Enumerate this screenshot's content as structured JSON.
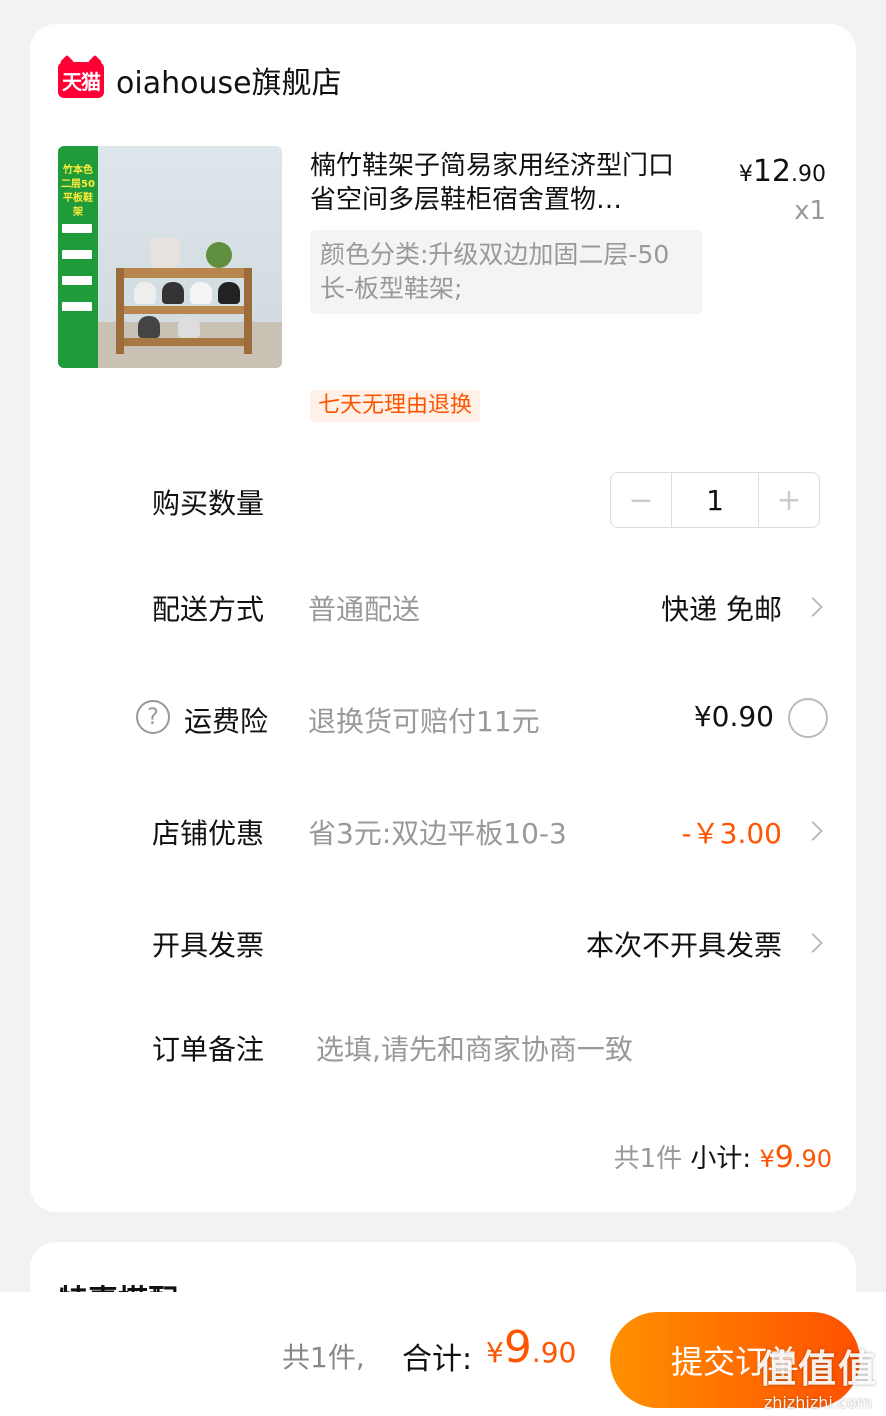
{
  "shop": {
    "badge": "天猫",
    "name": "oiahouse旗舰店"
  },
  "product": {
    "image_band_text": "竹本色 二层50 平板鞋架",
    "title": "楠竹鞋架子简易家用经济型门口省空间多层鞋柜宿舍置物…",
    "sku": "颜色分类:升级双边加固二层-50长-板型鞋架;",
    "price_symbol": "¥",
    "price_int": "12",
    "price_dec": ".90",
    "qty": "x1",
    "tag": "七天无理由退换"
  },
  "quantity": {
    "label": "购买数量",
    "minus": "−",
    "value": "1",
    "plus": "+"
  },
  "delivery": {
    "label": "配送方式",
    "method": "普通配送",
    "value": "快递 免邮"
  },
  "insurance": {
    "help": "?",
    "label": "运费险",
    "desc": "退换货可赔付11元",
    "price": "¥0.90"
  },
  "coupon": {
    "label": "店铺优惠",
    "desc": "省3元:双边平板10-3",
    "value": "-￥3.00"
  },
  "invoice": {
    "label": "开具发票",
    "value": "本次不开具发票"
  },
  "note": {
    "label": "订单备注",
    "placeholder": "选填,请先和商家协商一致"
  },
  "subtotal": {
    "count": "共1件",
    "label": "小计:",
    "symbol": "¥",
    "int": "9",
    "dec": ".90"
  },
  "recommend": {
    "title": "特惠搭配"
  },
  "bottom": {
    "count": "共1件,",
    "total_label": "合计:",
    "symbol": "¥",
    "int": "9",
    "dec": ".90",
    "submit": "提交订单"
  },
  "watermark": {
    "big": "值值值",
    "small": "zhizhizhi.com"
  },
  "colors": {
    "accent": "#ff5500",
    "tmall": "#ff0036",
    "button_gradient_start": "#ff9000",
    "button_gradient_end": "#ff5000"
  }
}
